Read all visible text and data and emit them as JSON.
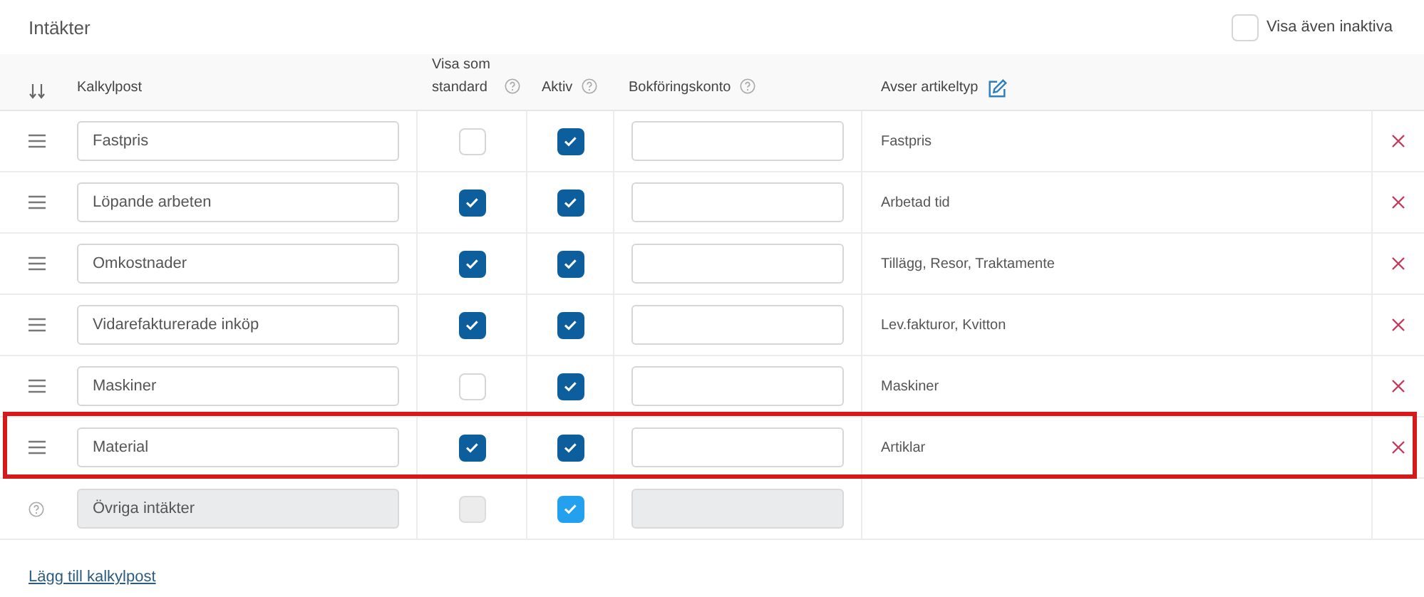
{
  "title": "Intäkter",
  "show_inactive": {
    "label": "Visa även inaktiva",
    "checked": false
  },
  "columns": [
    {
      "label": "Kalkylpost"
    },
    {
      "label": "Visa som standard",
      "help": true
    },
    {
      "label": "Aktiv",
      "help": true
    },
    {
      "label": "Bokföringskonto",
      "help": true
    },
    {
      "label": "Avser artikeltyp",
      "editable": true
    }
  ],
  "rows": [
    {
      "name": "Fastpris",
      "show_default": false,
      "active": true,
      "account": "",
      "article_type": "Fastpris",
      "disabled": false,
      "highlighted": false
    },
    {
      "name": "Löpande arbeten",
      "show_default": true,
      "active": true,
      "account": "",
      "article_type": "Arbetad tid",
      "disabled": false,
      "highlighted": false
    },
    {
      "name": "Omkostnader",
      "show_default": true,
      "active": true,
      "account": "",
      "article_type": "Tillägg, Resor, Traktamente",
      "disabled": false,
      "highlighted": false
    },
    {
      "name": "Vidarefakturerade inköp",
      "show_default": true,
      "active": true,
      "account": "",
      "article_type": "Lev.fakturor, Kvitton",
      "disabled": false,
      "highlighted": false
    },
    {
      "name": "Maskiner",
      "show_default": false,
      "active": true,
      "account": "",
      "article_type": "Maskiner",
      "disabled": false,
      "highlighted": false
    },
    {
      "name": "Material",
      "show_default": true,
      "active": true,
      "account": "",
      "article_type": "Artiklar",
      "disabled": false,
      "highlighted": true
    },
    {
      "name": "Övriga intäkter",
      "show_default": false,
      "active": true,
      "account": "",
      "disabled": true,
      "highlighted": false
    }
  ],
  "add_link": "Lägg till kalkylpost"
}
